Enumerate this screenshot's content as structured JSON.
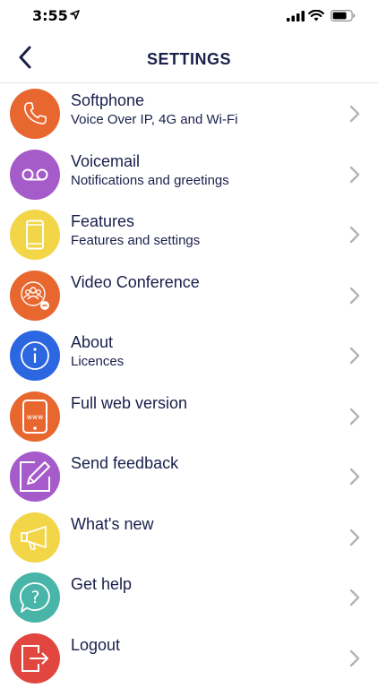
{
  "status": {
    "time": "3:55"
  },
  "nav": {
    "title": "SETTINGS"
  },
  "colors": {
    "orange": "#e8672f",
    "purple": "#a55bc9",
    "yellow": "#f2d648",
    "blue": "#2c66e0",
    "teal": "#48b5a8",
    "red": "#e2473f",
    "navy": "#1a1f4b",
    "chevron": "#b3b3b8"
  },
  "items": [
    {
      "title": "Softphone",
      "subtitle": "Voice Over IP, 4G and Wi-Fi",
      "icon": "phone-icon",
      "color": "#e8672f"
    },
    {
      "title": "Voicemail",
      "subtitle": "Notifications and greetings",
      "icon": "voicemail-icon",
      "color": "#a55bc9"
    },
    {
      "title": "Features",
      "subtitle": "Features and settings",
      "icon": "mobile-icon",
      "color": "#f2d648"
    },
    {
      "title": "Video Conference",
      "subtitle": "",
      "icon": "group-icon",
      "color": "#e8672f"
    },
    {
      "title": "About",
      "subtitle": "Licences",
      "icon": "info-icon",
      "color": "#2c66e0"
    },
    {
      "title": "Full web version",
      "subtitle": "",
      "icon": "web-phone-icon",
      "color": "#e8672f"
    },
    {
      "title": "Send feedback",
      "subtitle": "",
      "icon": "edit-icon",
      "color": "#a55bc9"
    },
    {
      "title": "What's new",
      "subtitle": "",
      "icon": "megaphone-icon",
      "color": "#f2d648"
    },
    {
      "title": "Get help",
      "subtitle": "",
      "icon": "help-bubble-icon",
      "color": "#48b5a8"
    },
    {
      "title": "Logout",
      "subtitle": "",
      "icon": "logout-icon",
      "color": "#e2473f"
    }
  ]
}
